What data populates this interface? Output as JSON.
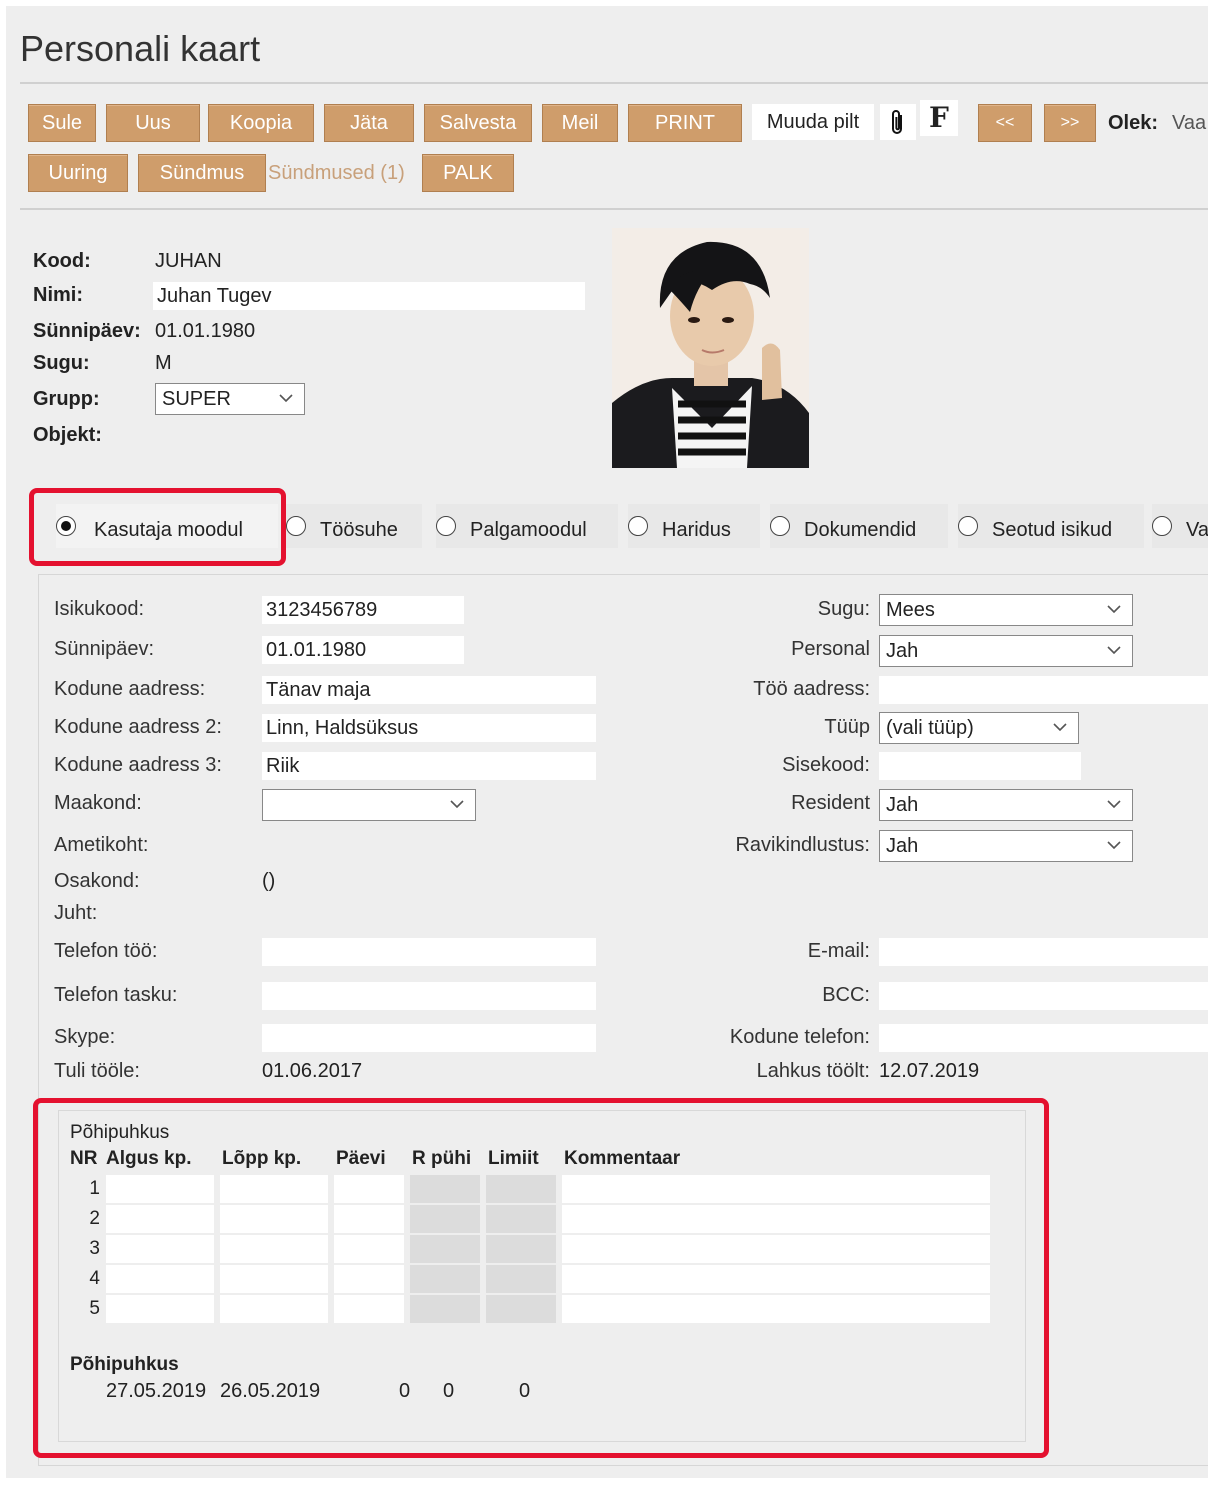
{
  "page": {
    "title": "Personali kaart"
  },
  "toolbar": {
    "buttons": [
      "Sule",
      "Uus",
      "Koopia",
      "Jäta",
      "Salvesta",
      "Meil",
      "PRINT"
    ],
    "change_picture": "Muuda pilt",
    "f_label": "F",
    "prev": "<<",
    "next": ">>",
    "status_label": "Olek:",
    "status_value": "Vaa",
    "row2": {
      "survey": "Uuring",
      "event": "Sündmus",
      "events_link": "Sündmused (1)",
      "salary": "PALK"
    }
  },
  "header": {
    "code_label": "Kood:",
    "code_value": "JUHAN",
    "name_label": "Nimi:",
    "name_value": "Juhan Tugev",
    "birth_label": "Sünnipäev:",
    "birth_value": "01.01.1980",
    "gender_label": "Sugu:",
    "gender_value": "M",
    "group_label": "Grupp:",
    "group_value": "SUPER",
    "object_label": "Objekt:"
  },
  "tabs": [
    {
      "label": "Kasutaja moodul",
      "selected": true
    },
    {
      "label": "Töösuhe",
      "selected": false
    },
    {
      "label": "Palgamoodul",
      "selected": false
    },
    {
      "label": "Haridus",
      "selected": false
    },
    {
      "label": "Dokumendid",
      "selected": false
    },
    {
      "label": "Seotud isikud",
      "selected": false
    },
    {
      "label": "Va",
      "selected": false
    }
  ],
  "form": {
    "left": {
      "isikukood_label": "Isikukood:",
      "isikukood": "3123456789",
      "synnipaev_label": "Sünnipäev:",
      "synnipaev": "01.01.1980",
      "aadress_label": "Kodune aadress:",
      "aadress": "Tänav  maja",
      "aadress2_label": "Kodune aadress 2:",
      "aadress2": "Linn, Haldsüksus",
      "aadress3_label": "Kodune aadress 3:",
      "aadress3": "Riik",
      "maakond_label": "Maakond:",
      "maakond": "",
      "ametikoht_label": "Ametikoht:",
      "osakond_label": "Osakond:",
      "osakond": "()",
      "juht_label": "Juht:",
      "telefon_too_label": "Telefon töö:",
      "telefon_too": "",
      "telefon_tasku_label": "Telefon tasku:",
      "telefon_tasku": "",
      "skype_label": "Skype:",
      "skype": "",
      "tuli_label": "Tuli tööle:",
      "tuli": "01.06.2017"
    },
    "right": {
      "sugu_label": "Sugu:",
      "sugu": "Mees",
      "personal_label": "Personal",
      "personal": "Jah",
      "too_aadress_label": "Töö aadress:",
      "too_aadress": "",
      "tyyp_label": "Tüüp",
      "tyyp": "(vali tüüp)",
      "sisekood_label": "Sisekood:",
      "sisekood": "",
      "resident_label": "Resident",
      "resident": "Jah",
      "ravi_label": "Ravikindlustus:",
      "ravi": "Jah",
      "email_label": "E-mail:",
      "email": "",
      "bcc_label": "BCC:",
      "bcc": "",
      "kodune_tel_label": "Kodune telefon:",
      "kodune_tel": "",
      "lahkus_label": "Lahkus töölt:",
      "lahkus": "12.07.2019"
    }
  },
  "vacation": {
    "title": "Põhipuhkus",
    "columns": [
      "NR",
      "Algus kp.",
      "Lõpp kp.",
      "Päevi",
      "R pühi",
      "Limiit",
      "Kommentaar"
    ],
    "rows": [
      "1",
      "2",
      "3",
      "4",
      "5"
    ],
    "summary_title": "Põhipuhkus",
    "summary": {
      "start": "27.05.2019",
      "end": "26.05.2019",
      "days": "0",
      "holidays": "0",
      "limit": "0"
    }
  },
  "colors": {
    "button_bg": "#cf9d6b",
    "highlight": "#e4112f",
    "panel_bg": "#eeeeee"
  }
}
